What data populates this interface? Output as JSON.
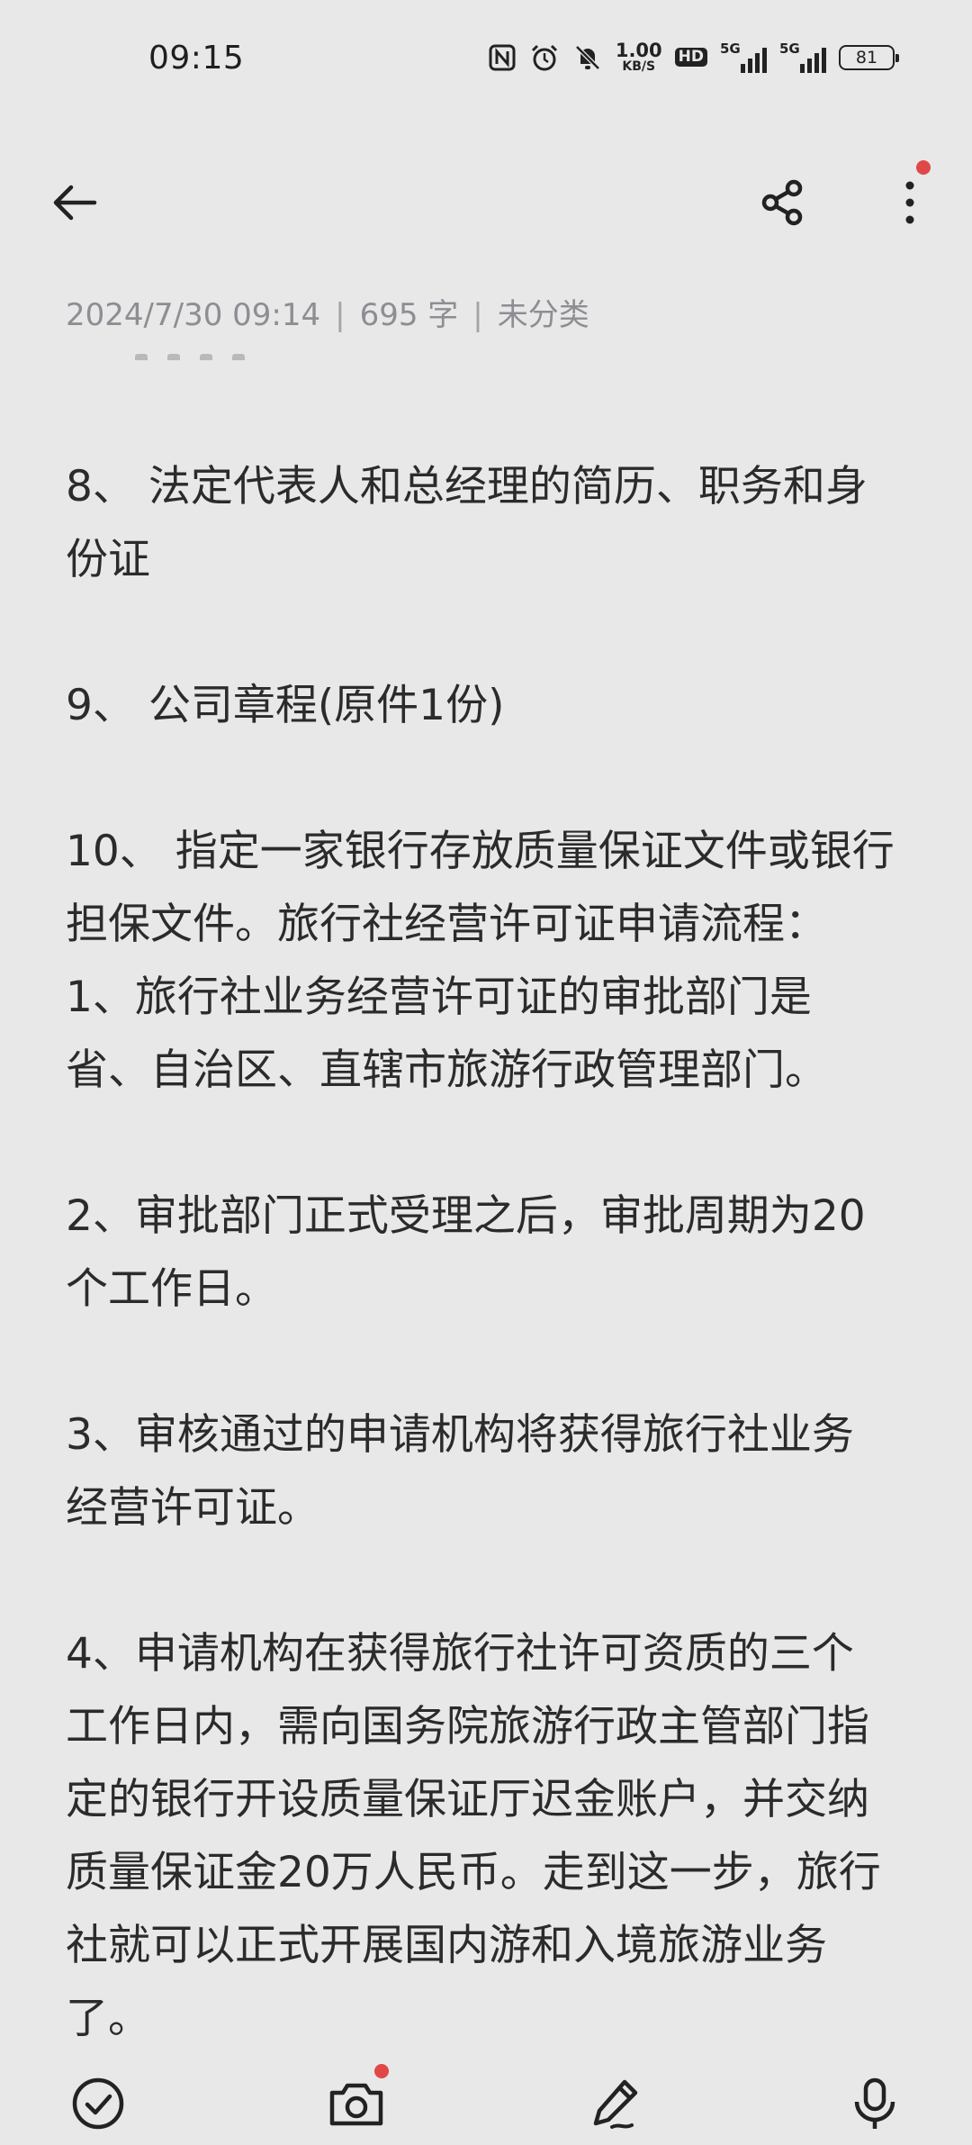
{
  "status_bar": {
    "time": "09:15",
    "net_speed_value": "1.00",
    "net_speed_unit": "KB/S",
    "hd_label": "HD",
    "signal_1_label": "5G",
    "signal_2_label": "5G",
    "battery": "81"
  },
  "toolbar": {
    "back": "back-arrow-icon",
    "share": "share-icon",
    "more": "more-vertical-icon",
    "more_badge_color": "#e04848"
  },
  "meta": {
    "datetime": "2024/7/30 09:14",
    "word_count": "695 字",
    "category": "未分类",
    "separator": "|"
  },
  "note": {
    "paragraphs": [
      [
        "8、 法定代表人和总经理的简历、职务和身",
        "份证"
      ],
      [
        "9、 公司章程(原件1份)"
      ],
      [
        "10、 指定一家银行存放质量保证文件或银行",
        "担保文件。旅行社经营许可证申请流程：",
        "1、旅行社业务经营许可证的审批部门是",
        "省、自治区、直辖市旅游行政管理部门。"
      ],
      [
        "2、审批部门正式受理之后，审批周期为20",
        "个工作日。"
      ],
      [
        "3、审核通过的申请机构将获得旅行社业务",
        "经营许可证。"
      ],
      [
        "4、申请机构在获得旅行社许可资质的三个",
        "工作日内，需向国务院旅游行政主管部门指",
        "定的银行开设质量保证厅迟金账户，并交纳",
        "质量保证金20万人民币。走到这一步，旅行",
        "社就可以正式开展国内游和入境旅游业务",
        "了。"
      ]
    ]
  },
  "bottom_bar": {
    "items": [
      "checklist-icon",
      "camera-icon",
      "handwriting-pen-icon",
      "microphone-icon"
    ],
    "camera_badge_color": "#e04848"
  }
}
